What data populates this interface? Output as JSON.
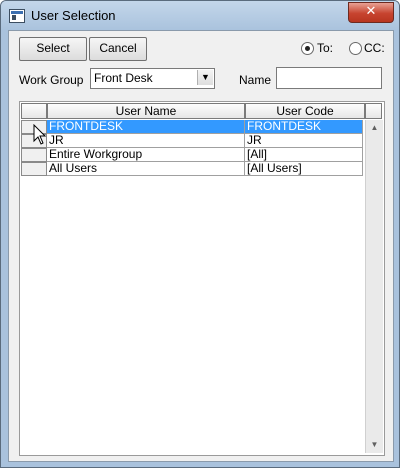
{
  "window": {
    "title": "User Selection",
    "close_glyph": "✕"
  },
  "toolbar": {
    "select_label": "Select",
    "cancel_label": "Cancel"
  },
  "recipient": {
    "to_label": "To:",
    "cc_label": "CC:",
    "selected": "to"
  },
  "filters": {
    "workgroup_label": "Work Group",
    "workgroup_value": "Front Desk",
    "name_label": "Name",
    "name_value": ""
  },
  "grid": {
    "columns": [
      "User Name",
      "User Code"
    ],
    "rows": [
      {
        "name": "FRONTDESK",
        "code": "FRONTDESK",
        "selected": true
      },
      {
        "name": "JR",
        "code": "JR"
      },
      {
        "name": "Entire Workgroup",
        "code": "[All]"
      },
      {
        "name": "All Users",
        "code": "[All Users]"
      }
    ]
  },
  "colors": {
    "selection": "#3399ff",
    "titlebar": "#a9c2dd",
    "close": "#c7442f"
  }
}
